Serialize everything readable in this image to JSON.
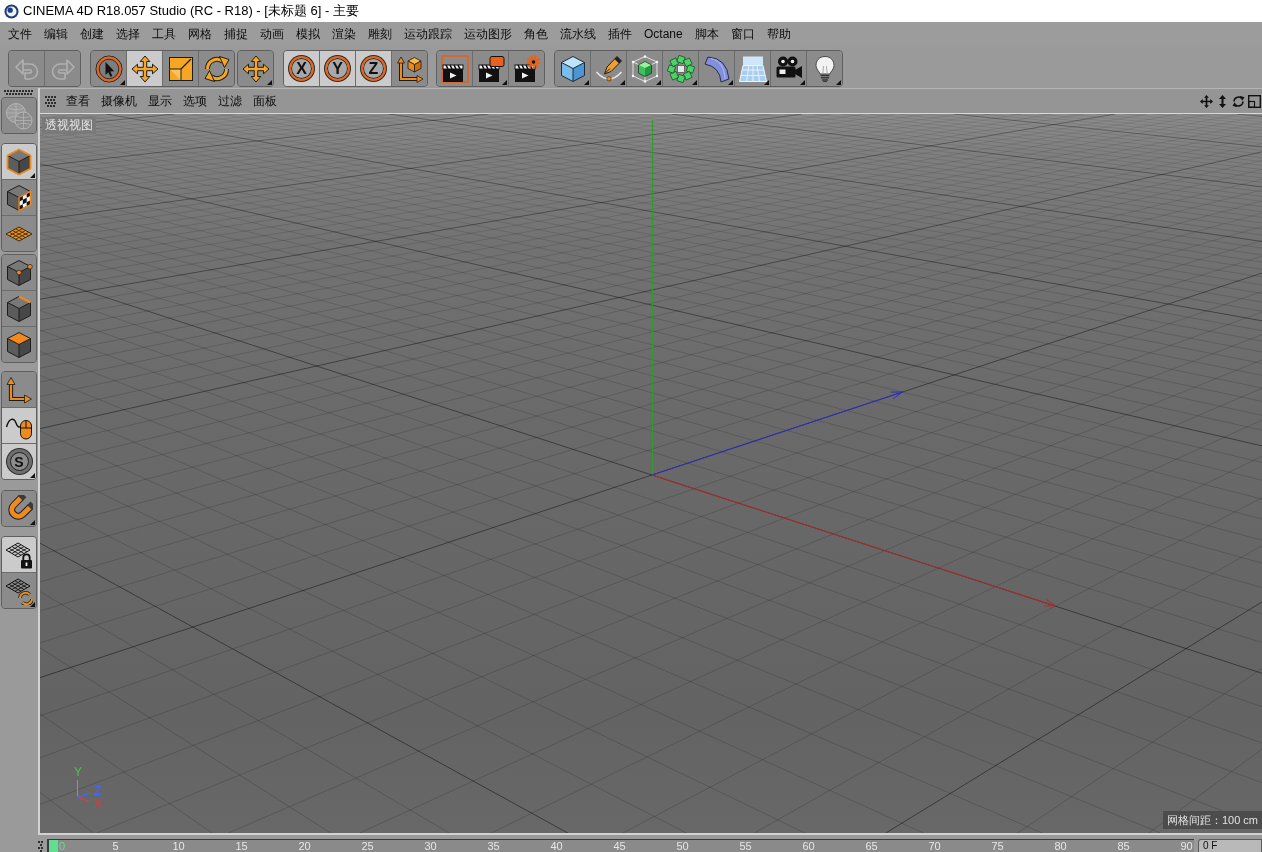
{
  "window": {
    "title": "CINEMA 4D R18.057 Studio (RC - R18) - [未标题 6] - 主要"
  },
  "menu_bar": [
    "文件",
    "编辑",
    "创建",
    "选择",
    "工具",
    "网格",
    "捕捉",
    "动画",
    "模拟",
    "渲染",
    "雕刻",
    "运动跟踪",
    "运动图形",
    "角色",
    "流水线",
    "插件",
    "Octane",
    "脚本",
    "窗口",
    "帮助"
  ],
  "toolbar": {
    "groups": [
      {
        "items": [
          {
            "kind": "undo",
            "on": false,
            "disabled": true,
            "dropdown": false
          },
          {
            "kind": "redo",
            "on": false,
            "disabled": true,
            "dropdown": false
          }
        ]
      },
      {
        "items": [
          {
            "kind": "select",
            "on": false,
            "disabled": false,
            "dropdown": true
          },
          {
            "kind": "move",
            "on": true,
            "disabled": false,
            "dropdown": false
          },
          {
            "kind": "scale",
            "on": false,
            "disabled": false,
            "dropdown": false
          },
          {
            "kind": "rotate",
            "on": false,
            "disabled": false,
            "dropdown": false
          }
        ]
      },
      {
        "items": [
          {
            "kind": "recent",
            "on": false,
            "disabled": false,
            "dropdown": true
          }
        ]
      },
      {
        "items": [
          {
            "kind": "axislock",
            "label": "X",
            "on": true,
            "disabled": false,
            "dropdown": false
          },
          {
            "kind": "axislock",
            "label": "Y",
            "on": true,
            "disabled": false,
            "dropdown": false
          },
          {
            "kind": "axislock",
            "label": "Z",
            "on": true,
            "disabled": false,
            "dropdown": false
          },
          {
            "kind": "coord",
            "on": false,
            "disabled": false,
            "dropdown": false
          }
        ]
      },
      {
        "items": [
          {
            "kind": "renderview",
            "on": false,
            "disabled": false,
            "dropdown": false
          },
          {
            "kind": "renderpicture",
            "on": false,
            "disabled": false,
            "dropdown": true
          },
          {
            "kind": "rendersettings",
            "on": false,
            "disabled": false,
            "dropdown": false
          }
        ]
      },
      {
        "items": [
          {
            "kind": "cube",
            "on": false,
            "disabled": false,
            "dropdown": true
          },
          {
            "kind": "pen",
            "on": false,
            "disabled": false,
            "dropdown": true
          },
          {
            "kind": "subdivision",
            "on": false,
            "disabled": false,
            "dropdown": true
          },
          {
            "kind": "cloner",
            "on": false,
            "disabled": false,
            "dropdown": true
          },
          {
            "kind": "deformer",
            "on": false,
            "disabled": false,
            "dropdown": true
          },
          {
            "kind": "floor",
            "on": false,
            "disabled": false,
            "dropdown": true
          },
          {
            "kind": "camera",
            "on": false,
            "disabled": false,
            "dropdown": true
          },
          {
            "kind": "light",
            "on": false,
            "disabled": false,
            "dropdown": true
          }
        ]
      }
    ]
  },
  "tool_palette": {
    "groups": [
      {
        "items": [
          {
            "kind": "globe",
            "on": false,
            "disabled": true,
            "dropdown": false
          }
        ]
      },
      {
        "items": [
          {
            "kind": "model",
            "on": true,
            "disabled": false,
            "dropdown": true
          },
          {
            "kind": "texture",
            "on": false,
            "disabled": false,
            "dropdown": false
          },
          {
            "kind": "workplane",
            "on": false,
            "disabled": false,
            "dropdown": false
          }
        ]
      },
      {
        "items": [
          {
            "kind": "points",
            "on": false,
            "disabled": false,
            "dropdown": false
          },
          {
            "kind": "edges",
            "on": false,
            "disabled": false,
            "dropdown": false
          },
          {
            "kind": "polygons",
            "on": false,
            "disabled": false,
            "dropdown": false
          }
        ]
      },
      {
        "items": [
          {
            "kind": "axis",
            "on": false,
            "disabled": false,
            "dropdown": false
          },
          {
            "kind": "tweak",
            "on": true,
            "disabled": false,
            "dropdown": false
          },
          {
            "kind": "solo",
            "label": "S",
            "on": true,
            "disabled": false,
            "dropdown": true
          }
        ]
      },
      {
        "items": [
          {
            "kind": "snap",
            "on": false,
            "disabled": false,
            "dropdown": true
          }
        ]
      },
      {
        "items": [
          {
            "kind": "lockplane",
            "on": true,
            "disabled": false,
            "dropdown": false
          },
          {
            "kind": "alignplane",
            "on": false,
            "disabled": false,
            "dropdown": true
          }
        ]
      }
    ]
  },
  "viewport": {
    "menu": [
      "查看",
      "摄像机",
      "显示",
      "选项",
      "过滤",
      "面板"
    ],
    "view_name": "透视视图",
    "grid_spacing": "网格间距：100 cm",
    "axis_gizmo": [
      {
        "label": "Y",
        "color": "#4cc24c"
      },
      {
        "label": "Z",
        "color": "#4466ff"
      },
      {
        "label": "X",
        "color": "#e03a3a"
      }
    ]
  },
  "timeline": {
    "ticks": [
      {
        "label": "0",
        "selected": true
      },
      {
        "label": "5",
        "selected": false
      },
      {
        "label": "10",
        "selected": false
      },
      {
        "label": "15",
        "selected": false
      },
      {
        "label": "20",
        "selected": false
      },
      {
        "label": "25",
        "selected": false
      },
      {
        "label": "30",
        "selected": false
      },
      {
        "label": "35",
        "selected": false
      },
      {
        "label": "40",
        "selected": false
      },
      {
        "label": "45",
        "selected": false
      },
      {
        "label": "50",
        "selected": false
      },
      {
        "label": "55",
        "selected": false
      },
      {
        "label": "60",
        "selected": false
      },
      {
        "label": "65",
        "selected": false
      },
      {
        "label": "70",
        "selected": false
      },
      {
        "label": "75",
        "selected": false
      },
      {
        "label": "80",
        "selected": false
      },
      {
        "label": "85",
        "selected": false
      },
      {
        "label": "90",
        "selected": false
      }
    ],
    "frame_field": "0 F"
  }
}
